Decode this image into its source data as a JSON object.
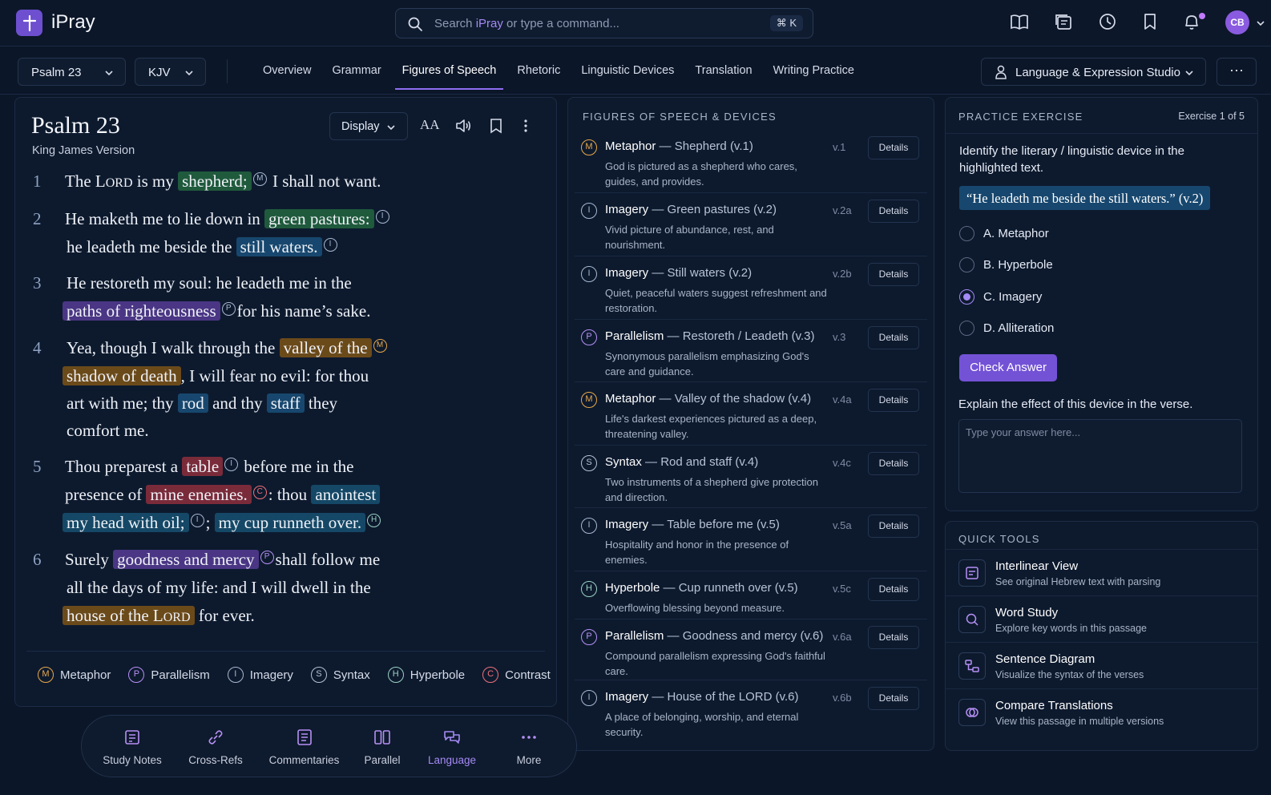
{
  "app": {
    "name": "iPray",
    "avatar": "CB"
  },
  "search": {
    "prefix": "Search ",
    "brand": "iPray",
    "suffix": " or type a command...",
    "shortcut": "⌘ K"
  },
  "toolbar": {
    "passage": "Psalm 23",
    "version": "KJV",
    "tabs": [
      "Overview",
      "Grammar",
      "Figures of Speech",
      "Rhetoric",
      "Linguistic Devices",
      "Translation",
      "Writing Practice"
    ],
    "active_tab": "Figures of Speech",
    "studio": "Language & Expression Studio",
    "more": "···"
  },
  "reader": {
    "title": "Psalm 23",
    "version_name": "King James Version",
    "display_label": "Display",
    "text_size": "AA",
    "verses": [
      {
        "n": "1",
        "lines": [
          "The LORD is my shepherd; I shall not want."
        ]
      },
      {
        "n": "2",
        "lines": [
          "He maketh me to lie down in green pastures:",
          "he leadeth me beside the still waters."
        ]
      },
      {
        "n": "3",
        "lines": [
          "He restoreth my soul: he leadeth me in the",
          "paths of righteousness for his name's sake."
        ]
      },
      {
        "n": "4",
        "lines": [
          "Yea, though I walk through the valley of the",
          "shadow of death, I will fear no evil: for thou",
          "art with me; thy rod and thy staff they",
          "comfort me."
        ]
      },
      {
        "n": "5",
        "lines": [
          "Thou preparest a table before me in the",
          "presence of mine enemies: thou anointest",
          "my head with oil; my cup runneth over."
        ]
      },
      {
        "n": "6",
        "lines": [
          "Surely goodness and mercy shall follow me",
          "all the days of my life: and I will dwell in the",
          "house of the LORD for ever."
        ]
      }
    ],
    "legend": [
      {
        "mark": "M",
        "label": "Metaphor"
      },
      {
        "mark": "P",
        "label": "Parallelism"
      },
      {
        "mark": "I",
        "label": "Imagery"
      },
      {
        "mark": "S",
        "label": "Syntax"
      },
      {
        "mark": "H",
        "label": "Hyperbole"
      },
      {
        "mark": "C",
        "label": "Contrast"
      }
    ]
  },
  "figures": {
    "heading": "FIGURES OF SPEECH & DEVICES",
    "button_label": "Details",
    "items": [
      {
        "mark": "M",
        "type": "Metaphor",
        "ref": "Shepherd (v.1)",
        "verse": "v.1",
        "desc": "God is pictured as a shepherd who cares, guides, and provides."
      },
      {
        "mark": "I",
        "type": "Imagery",
        "ref": "Green pastures (v.2)",
        "verse": "v.2a",
        "desc": "Vivid picture of abundance, rest, and nourishment."
      },
      {
        "mark": "I",
        "type": "Imagery",
        "ref": "Still waters (v.2)",
        "verse": "v.2b",
        "desc": "Quiet, peaceful waters suggest refreshment and restoration."
      },
      {
        "mark": "P",
        "type": "Parallelism",
        "ref": "Restoreth / Leadeth (v.3)",
        "verse": "v.3",
        "desc": "Synonymous parallelism emphasizing God's care and guidance."
      },
      {
        "mark": "M",
        "type": "Metaphor",
        "ref": "Valley of the shadow (v.4)",
        "verse": "v.4a",
        "desc": "Life's darkest experiences pictured as a deep, threatening valley."
      },
      {
        "mark": "S",
        "type": "Syntax",
        "ref": "Rod and staff (v.4)",
        "verse": "v.4c",
        "desc": "Two instruments of a shepherd give protection and direction."
      },
      {
        "mark": "I",
        "type": "Imagery",
        "ref": "Table before me (v.5)",
        "verse": "v.5a",
        "desc": "Hospitality and honor in the presence of enemies."
      },
      {
        "mark": "H",
        "type": "Hyperbole",
        "ref": "Cup runneth over (v.5)",
        "verse": "v.5c",
        "desc": "Overflowing blessing beyond measure."
      },
      {
        "mark": "P",
        "type": "Parallelism",
        "ref": "Goodness and mercy (v.6)",
        "verse": "v.6a",
        "desc": "Compound parallelism expressing God's faithful care."
      },
      {
        "mark": "I",
        "type": "Imagery",
        "ref": "House of the LORD (v.6)",
        "verse": "v.6b",
        "desc": "A place of belonging, worship, and eternal security."
      }
    ]
  },
  "exercise": {
    "heading": "PRACTICE EXERCISE",
    "counter": "Exercise 1 of 5",
    "question": "Identify the literary / linguistic device in the highlighted text.",
    "quote": "“He leadeth me beside the still waters.” (v.2)",
    "options": [
      "A. Metaphor",
      "B. Hyperbole",
      "C. Imagery",
      "D. Alliteration"
    ],
    "selected": "C. Imagery",
    "check_label": "Check Answer",
    "explain_label": "Explain the effect of this device in the verse.",
    "answer_placeholder": "Type your answer here..."
  },
  "quick_tools": {
    "heading": "QUICK TOOLS",
    "items": [
      {
        "title": "Interlinear View",
        "desc": "See original Hebrew text with parsing"
      },
      {
        "title": "Word Study",
        "desc": "Explore key words in this passage"
      },
      {
        "title": "Sentence Diagram",
        "desc": "Visualize the syntax of the verses"
      },
      {
        "title": "Compare Translations",
        "desc": "View this passage in multiple versions"
      }
    ]
  },
  "dock": {
    "items": [
      "Study Notes",
      "Cross-Refs",
      "Commentaries",
      "Parallel",
      "Language",
      "More"
    ],
    "active": "Language"
  },
  "colors": {
    "accent": "#7352d6",
    "background": "#0b1628",
    "metaphor": "#e8a84a",
    "parallelism": "#b690f5",
    "contrast": "#f07078"
  }
}
